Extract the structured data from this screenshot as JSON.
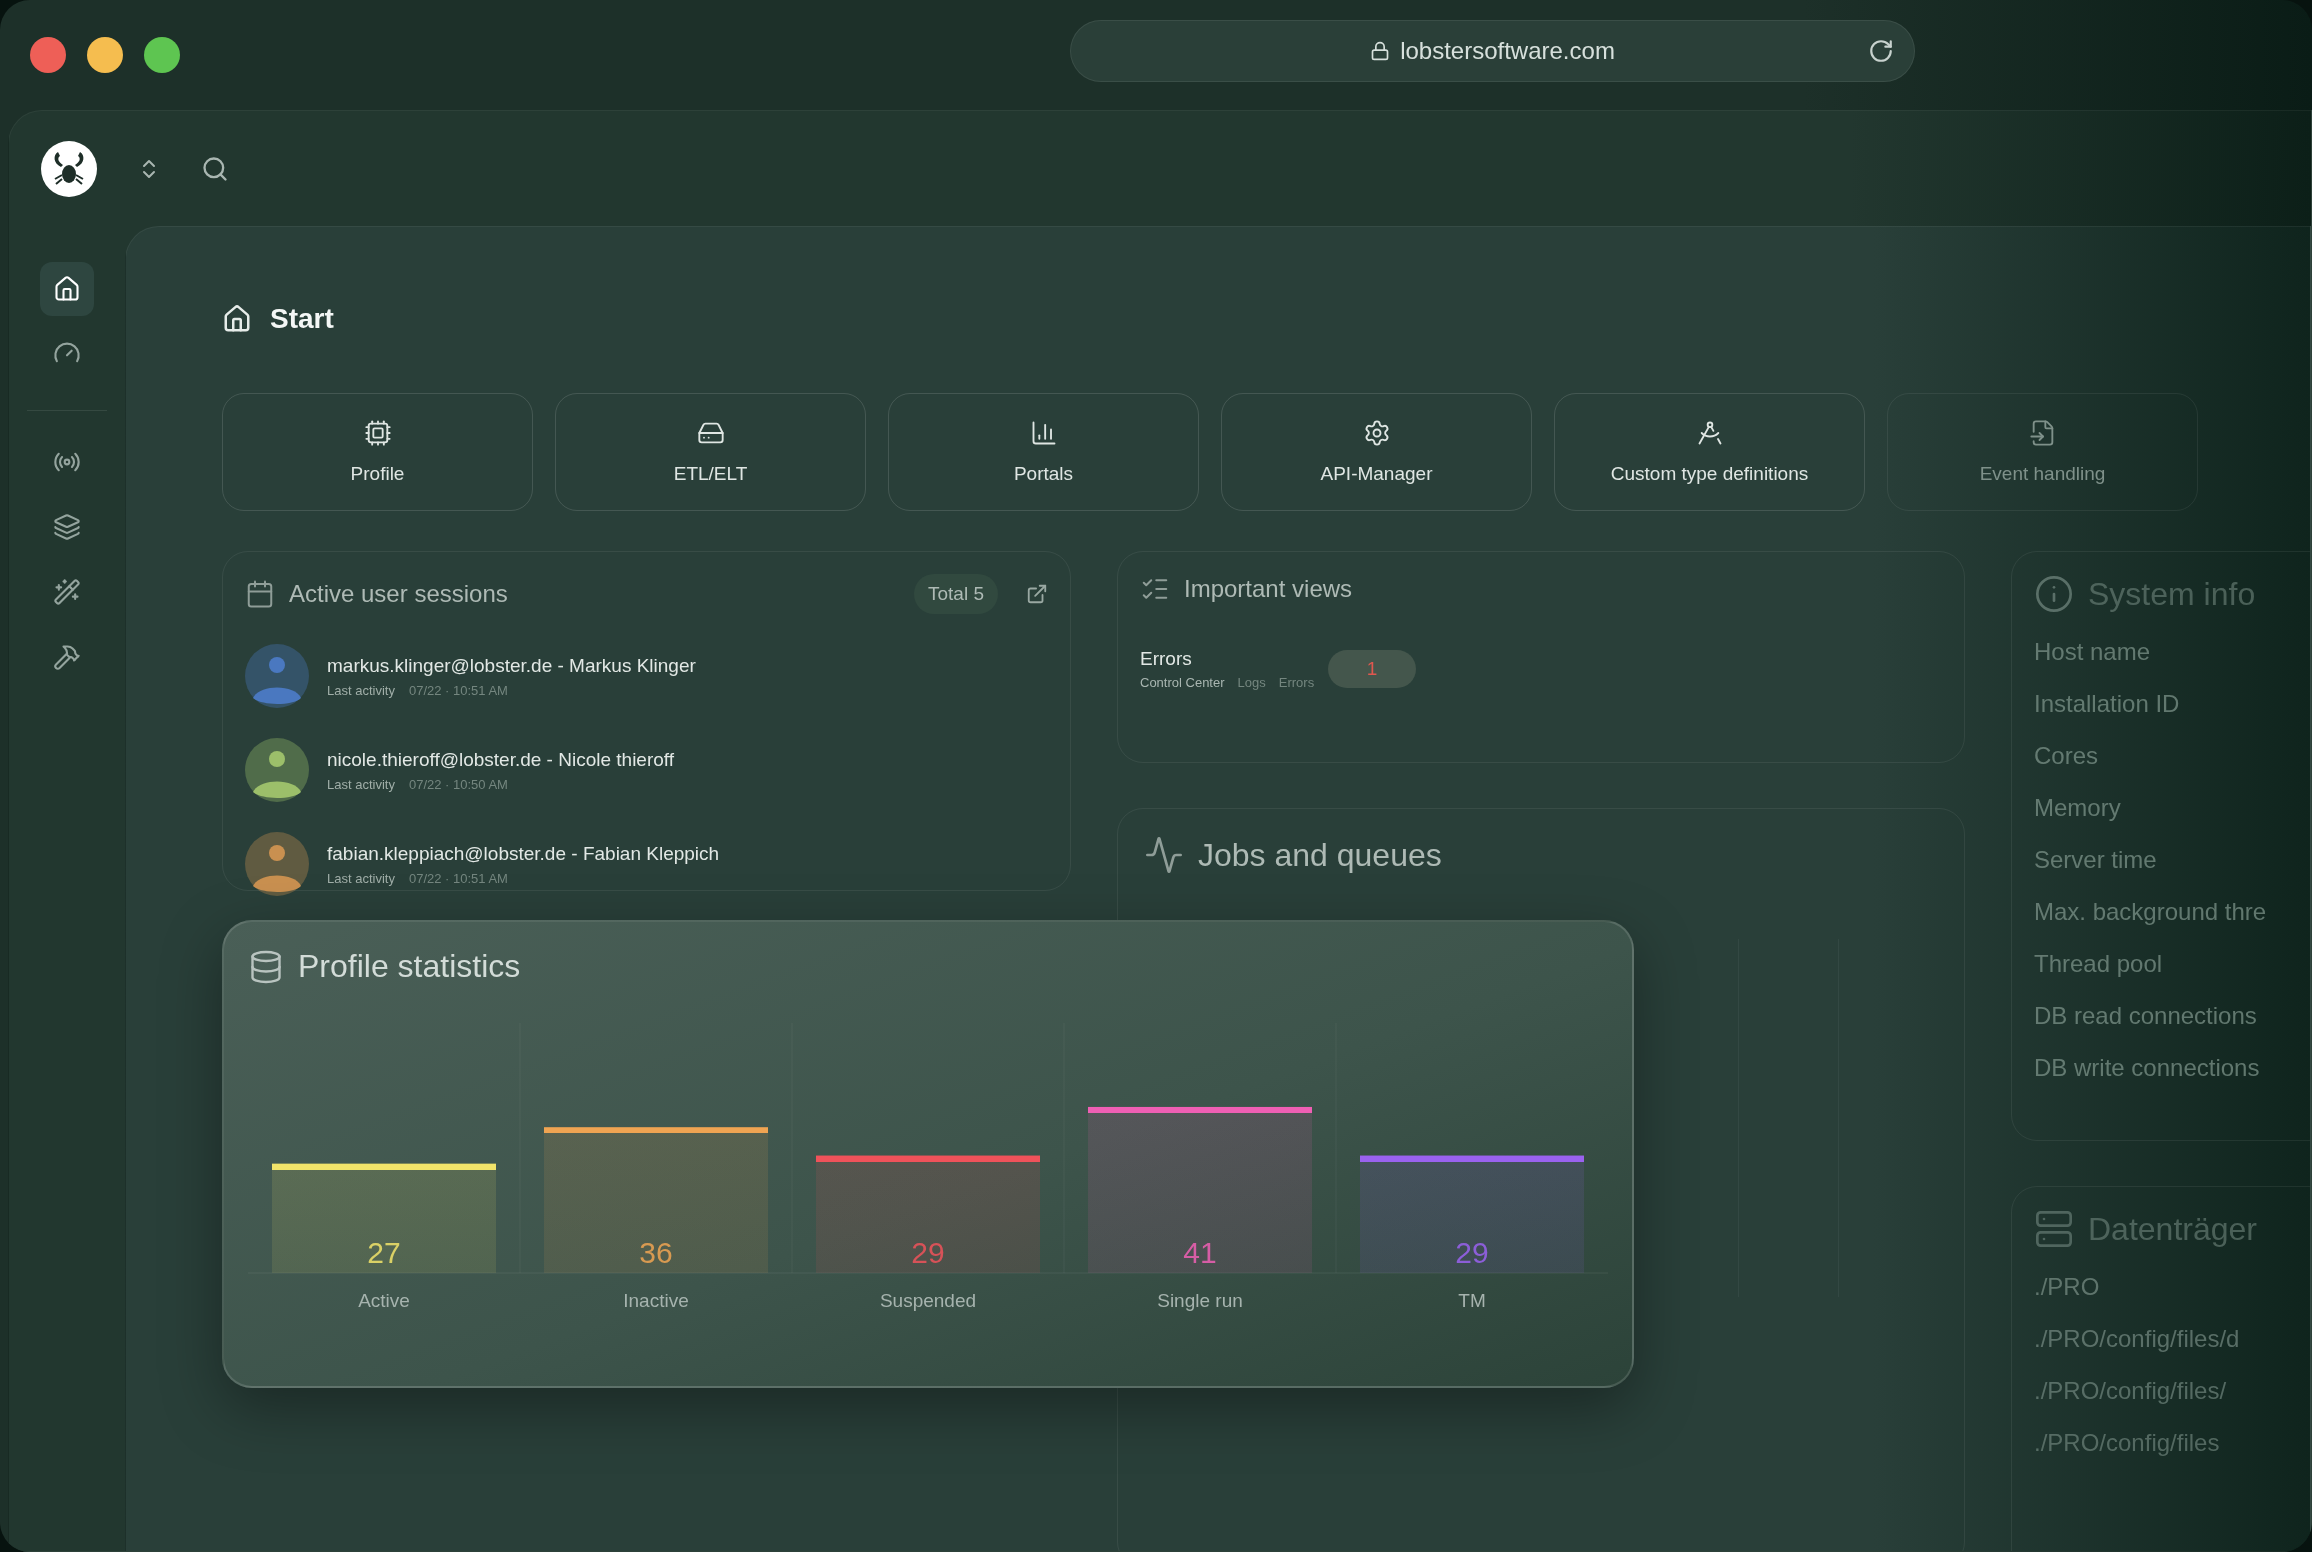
{
  "browser": {
    "url": "lobstersoftware.com"
  },
  "sidebar": {
    "groups": [
      [
        {
          "selected": true
        },
        {
          "selected": false
        }
      ],
      [
        {
          "selected": false
        },
        {
          "selected": false
        },
        {
          "selected": false
        },
        {
          "selected": false
        }
      ]
    ]
  },
  "page": {
    "title": "Start"
  },
  "tiles": [
    {
      "label": "Profile",
      "dimmed": false
    },
    {
      "label": "ETL/ELT",
      "dimmed": false
    },
    {
      "label": "Portals",
      "dimmed": false
    },
    {
      "label": "API-Manager",
      "dimmed": false
    },
    {
      "label": "Custom type definitions",
      "dimmed": false
    },
    {
      "label": "Event handling",
      "dimmed": true
    }
  ],
  "sessions": {
    "title": "Active user sessions",
    "total": "Total 5",
    "rows": [
      {
        "user": "markus.klinger@lobster.de - Markus Klinger",
        "meta_label": "Last activity",
        "time": "07/22 · 10:51 AM",
        "color": "#4a78c0"
      },
      {
        "user": "nicole.thieroff@lobster.de - Nicole thieroff",
        "meta_label": "Last activity",
        "time": "07/22 · 10:50 AM",
        "color": "#9cbf6a"
      },
      {
        "user": "fabian.kleppiach@lobster.de - Fabian Kleppich",
        "meta_label": "Last activity",
        "time": "07/22 · 10:51 AM",
        "color": "#c99050"
      }
    ]
  },
  "important_views": {
    "title": "Important views",
    "items": [
      {
        "name": "Errors",
        "path": [
          "Control Center",
          "Logs",
          "Errors"
        ],
        "count": "1"
      }
    ]
  },
  "jobs": {
    "title": "Jobs and queues"
  },
  "system_info": {
    "title": "System info",
    "rows": [
      "Host name",
      "Installation ID",
      "Cores",
      "Memory",
      "Server time",
      "Max. background thre",
      "Thread pool",
      "DB read connections",
      "DB write connections"
    ]
  },
  "storage": {
    "title": "Datenträger",
    "rows": [
      "./PRO",
      "./PRO/config/files/d",
      "./PRO/config/files/",
      "./PRO/config/files"
    ]
  },
  "profile_statistics": {
    "title": "Profile statistics",
    "chart_data": {
      "type": "bar",
      "categories": [
        "Active",
        "Inactive",
        "Suspended",
        "Single run",
        "TM"
      ],
      "values": [
        27,
        36,
        29,
        41,
        29
      ],
      "colors": [
        "#f2e46a",
        "#f0a452",
        "#f0525a",
        "#ef5fb4",
        "#9a62f0"
      ],
      "data_labels": true
    }
  }
}
